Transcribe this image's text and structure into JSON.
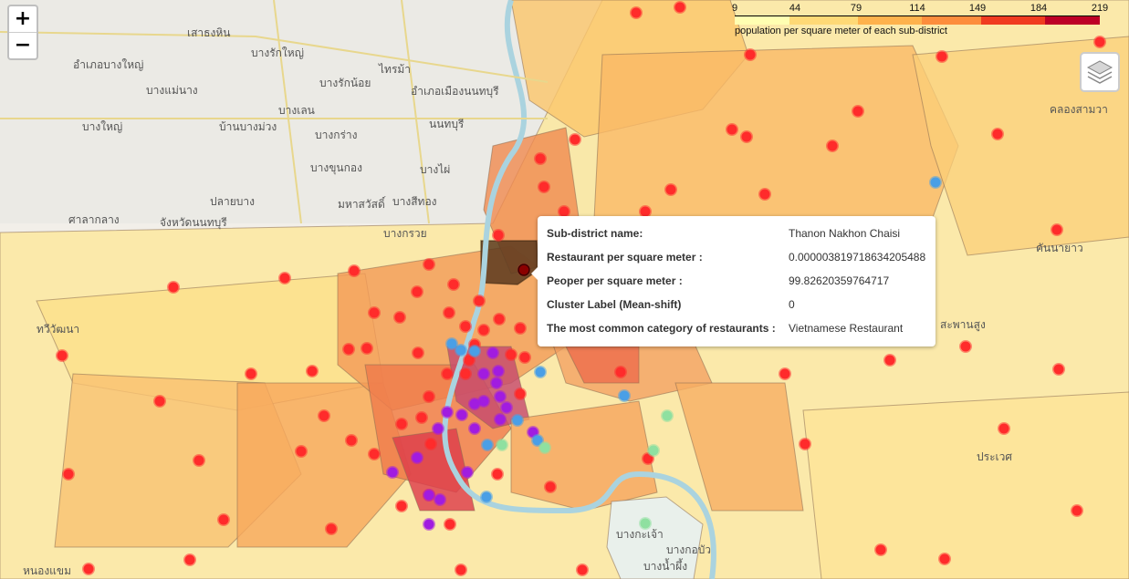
{
  "zoom": {
    "in_label": "+",
    "out_label": "−"
  },
  "legend": {
    "ticks": [
      "9",
      "44",
      "79",
      "114",
      "149",
      "184",
      "219"
    ],
    "caption": "population per square meter of each sub-district",
    "colors": [
      "#ffffb2",
      "#fed976",
      "#feb24c",
      "#fd8d3c",
      "#f03b20",
      "#bd0026"
    ]
  },
  "tooltip": {
    "rows": [
      {
        "key": "Sub-district name:",
        "value": "Thanon Nakhon Chaisi"
      },
      {
        "key": "Restaurant per square meter :",
        "value": "0.000003819718634205488"
      },
      {
        "key": "Peoper per square meter :",
        "value": "99.82620359764717"
      },
      {
        "key": "Cluster Label (Mean-shift)",
        "value": "0"
      },
      {
        "key": "The most common category of restaurants :",
        "value": "Vietnamese Restaurant"
      }
    ]
  },
  "map_labels": [
    "เสาธงหิน",
    "บางแม่นาง",
    "บางใหญ่",
    "บ้านบางม่วง",
    "ปลายบาง",
    "ศาลากลาง",
    "ไทรม้า",
    "นนทบุรี",
    "บางรักน้อย",
    "บางเลน",
    "บางกร่าง",
    "บางสีทอง",
    "บางกรวย",
    "อำเภอบางใหญ่",
    "อำเภอเมืองนนทบุรี",
    "บางรักใหญ่",
    "บางขุนกอง",
    "บางไผ่",
    "จังหวัดนนทบุรี",
    "มหาสวัสดิ์",
    "คลองสามวา",
    "คันนายาว",
    "สะพานสูง",
    "ประเวศ",
    "บางกะเจ้า",
    "บางกอบัว",
    "บางน้ำผึ้ง",
    "ทวีวัฒนา",
    "หนองแขม"
  ],
  "colors": {
    "highlight": "#5a3a1e",
    "dot_red": "#ff2b2b",
    "dot_purple": "#a11ce0",
    "dot_blue": "#4a9fe6",
    "dot_green": "#8fe0a0"
  }
}
